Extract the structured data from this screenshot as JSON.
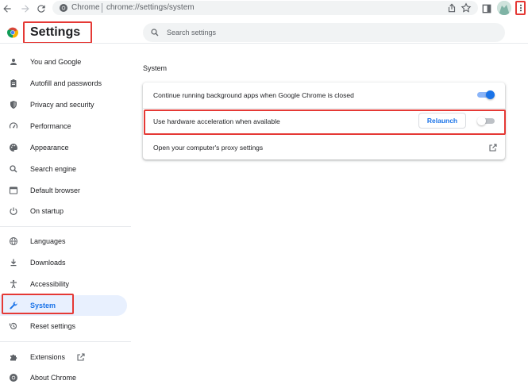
{
  "browser": {
    "site_label": "Chrome",
    "url": "chrome://settings/system"
  },
  "header": {
    "title": "Settings",
    "search_placeholder": "Search settings"
  },
  "sidebar": {
    "items": [
      {
        "label": "You and Google",
        "icon": "person-icon"
      },
      {
        "label": "Autofill and passwords",
        "icon": "clipboard-icon"
      },
      {
        "label": "Privacy and security",
        "icon": "shield-icon"
      },
      {
        "label": "Performance",
        "icon": "speedometer-icon"
      },
      {
        "label": "Appearance",
        "icon": "palette-icon"
      },
      {
        "label": "Search engine",
        "icon": "search-icon"
      },
      {
        "label": "Default browser",
        "icon": "browser-window-icon"
      },
      {
        "label": "On startup",
        "icon": "power-icon"
      },
      {
        "label": "Languages",
        "icon": "globe-icon"
      },
      {
        "label": "Downloads",
        "icon": "download-icon"
      },
      {
        "label": "Accessibility",
        "icon": "accessibility-icon"
      },
      {
        "label": "System",
        "icon": "wrench-icon",
        "active": true
      },
      {
        "label": "Reset settings",
        "icon": "history-icon"
      },
      {
        "label": "Extensions",
        "icon": "puzzle-icon"
      },
      {
        "label": "About Chrome",
        "icon": "chrome-logo-icon"
      }
    ]
  },
  "main": {
    "section_title": "System",
    "rows": [
      {
        "label": "Continue running background apps when Google Chrome is closed",
        "toggle_on": true
      },
      {
        "label": "Use hardware acceleration when available",
        "button_label": "Relaunch",
        "toggle_on": false
      },
      {
        "label": "Open your computer's proxy settings",
        "icon": "external-link-icon"
      }
    ]
  },
  "colors": {
    "accent": "#1a73e8",
    "toggle_on_track": "#8ab4f8",
    "toggle_off_track": "#bdc1c6",
    "highlight_annotation": "#e53935"
  }
}
